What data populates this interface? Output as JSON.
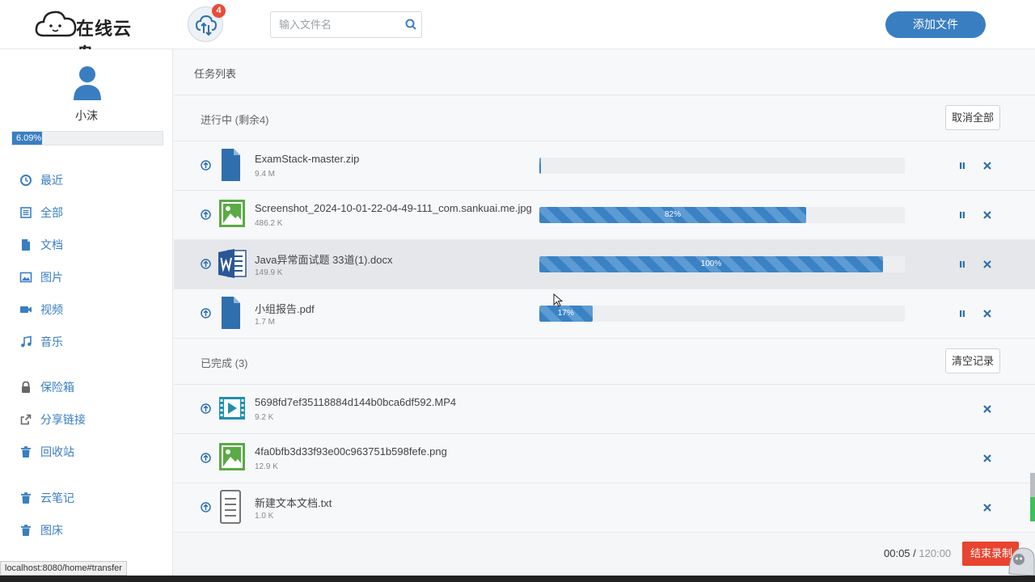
{
  "header": {
    "logo_text": "在线云盘",
    "transfer_badge": "4",
    "search_placeholder": "输入文件名",
    "add_file_label": "添加文件"
  },
  "sidebar": {
    "username": "小沫",
    "quota_percent": "6.09%",
    "quota_fraction": 0.0609,
    "items": [
      {
        "label": "最近",
        "icon": "clock-icon"
      },
      {
        "label": "全部",
        "icon": "list-icon"
      },
      {
        "label": "文档",
        "icon": "document-icon"
      },
      {
        "label": "图片",
        "icon": "image-icon"
      },
      {
        "label": "视频",
        "icon": "video-icon"
      },
      {
        "label": "音乐",
        "icon": "music-icon"
      },
      {
        "label": "保险箱",
        "icon": "lock-icon"
      },
      {
        "label": "分享链接",
        "icon": "share-icon"
      },
      {
        "label": "回收站",
        "icon": "trash-icon"
      },
      {
        "label": "云笔记",
        "icon": "trash-icon"
      },
      {
        "label": "图床",
        "icon": "trash-icon"
      }
    ]
  },
  "main": {
    "crumb": "任务列表",
    "in_progress": {
      "title": "进行中 (剩余4)",
      "action": "取消全部",
      "items": [
        {
          "name": "ExamStack-master.zip",
          "size": "9.4 M",
          "progress": 0.005,
          "progress_label": "",
          "icon": "file-icon"
        },
        {
          "name": "Screenshot_2024-10-01-22-04-49-111_com.sankuai.me.jpg",
          "size": "486.2 K",
          "progress": 0.73,
          "progress_label": "82%",
          "icon": "image-file-icon"
        },
        {
          "name": "Java异常面试题 33道(1).docx",
          "size": "149.9 K",
          "progress": 0.94,
          "progress_label": "100%",
          "icon": "word-icon"
        },
        {
          "name": "小组报告.pdf",
          "size": "1.7 M",
          "progress": 0.145,
          "progress_label": "17%",
          "icon": "file-icon"
        }
      ]
    },
    "completed": {
      "title": "已完成 (3)",
      "action": "清空记录",
      "items": [
        {
          "name": "5698fd7ef35118884d144b0bca6df592.MP4",
          "size": "9.2 K",
          "icon": "video-file-icon"
        },
        {
          "name": "4fa0bfb3d33f93e00c963751b598fefe.png",
          "size": "12.9 K",
          "icon": "image-file-icon"
        },
        {
          "name": "新建文本文档.txt",
          "size": "1.0 K",
          "icon": "text-file-icon"
        }
      ]
    }
  },
  "statusbar": {
    "url": "localhost:8080/home#transfer"
  },
  "recorder": {
    "elapsed": "00:05",
    "separator": " / ",
    "total": "120:00",
    "stop_label": "结束录制"
  },
  "colors": {
    "accent": "#3a7ec2",
    "danger": "#e8442f",
    "file_blue": "#2f6fad",
    "image_green": "#5aaa45"
  }
}
